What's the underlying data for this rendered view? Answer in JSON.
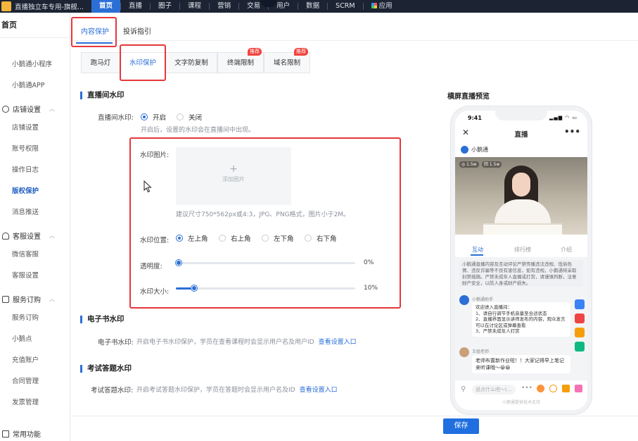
{
  "topbar": {
    "app_title": "直播独立车专用-旗舰...",
    "nav": [
      "首页",
      "直播",
      "圈子",
      "课程",
      "营销",
      "交易",
      "用户",
      "数据",
      "SCRM",
      "应用"
    ]
  },
  "sidebar": {
    "home": "首页",
    "items_top": [
      "小鹅通小程序",
      "小鹅通APP"
    ],
    "group_shop": "店铺设置",
    "shop_items": [
      "店铺设置",
      "账号权限",
      "操作日志",
      "版权保护",
      "消息推送"
    ],
    "group_service": "客服设置",
    "service_items": [
      "微信客服",
      "客服设置"
    ],
    "group_order": "服务订购",
    "order_items": [
      "服务订购",
      "小鹅点",
      "充值账户",
      "合同管理",
      "发票管理"
    ],
    "group_common": "常用功能"
  },
  "tabs_primary": [
    "内容保护",
    "投诉指引"
  ],
  "tabs_secondary": [
    "跑马灯",
    "水印保护",
    "文字防复制",
    "终端限制",
    "域名限制"
  ],
  "badges": {
    "terminal": "推荐",
    "domain": "推荐"
  },
  "live_watermark": {
    "section_title": "直播间水印",
    "label": "直播间水印:",
    "option_on": "开启",
    "option_off": "关闭",
    "hint": "开启后，设置的水印会在直播间中出现。",
    "image_label": "水印图片:",
    "upload_plus": "+",
    "upload_text": "添加图片",
    "image_hint": "建议尺寸750*562px或4:3，JPG、PNG格式，图片小于2M。",
    "position_label": "水印位置:",
    "positions": [
      "左上角",
      "右上角",
      "左下角",
      "右下角"
    ],
    "opacity_label": "透明度:",
    "opacity_value": "0%",
    "opacity_level": 0,
    "size_label": "水印大小:",
    "size_value": "10%",
    "size_level": 10
  },
  "ebook_watermark": {
    "section_title": "电子书水印",
    "label": "电子书水印:",
    "desc": "开启电子书水印保护，学员在查看课程时会显示用户名及用户ID",
    "link": "查看设置入口"
  },
  "exam_watermark": {
    "section_title": "考试答题水印",
    "label": "考试答题水印:",
    "desc": "开启考试答题水印保护，学员在答题时会显示用户名及ID",
    "link": "查看设置入口"
  },
  "preview": {
    "title": "横屏直播预览",
    "time": "9:41",
    "signal": "▂▄▆ ◠ ▭",
    "close": "✕",
    "header": "直播",
    "more": "•••",
    "author": "小鹅通",
    "video_tag1": "◎ 1.5w",
    "video_tag2": "回 1.5w",
    "tabs": [
      "互动",
      "排行榜",
      "介绍"
    ],
    "notice": "小鹅通直播内容及互动评论严禁传播违法违规、低俗色情、违反诈骗等不良有害信息，如有违规，小鹅通将采取封禁措施。严禁未成年人直播或打赏，请谨慎判断，注意财产安全，以防人身或财产损失。",
    "msg1_name": "小鹅通助手",
    "msg1_text": "欢迎进入直播间：\n1、请自行调节手机音量至合适状态\n2、直播界面显示讲师发布的内容，观众发言可以在讨论区或弹幕查看\n3、严禁未成年人打赏",
    "msg2_name": "王姐老师",
    "msg2_text": "老师布置新作业啦！！大家记得早上笔记来听课哦～😀😀",
    "input_placeholder": "说点什么吧～(…",
    "footer": "小鹅通提供技术支持"
  },
  "save_button": "保存",
  "colors": {
    "primary": "#2b6fd6",
    "highlight_box": "#e5373b",
    "topbar": "#1c2433"
  }
}
